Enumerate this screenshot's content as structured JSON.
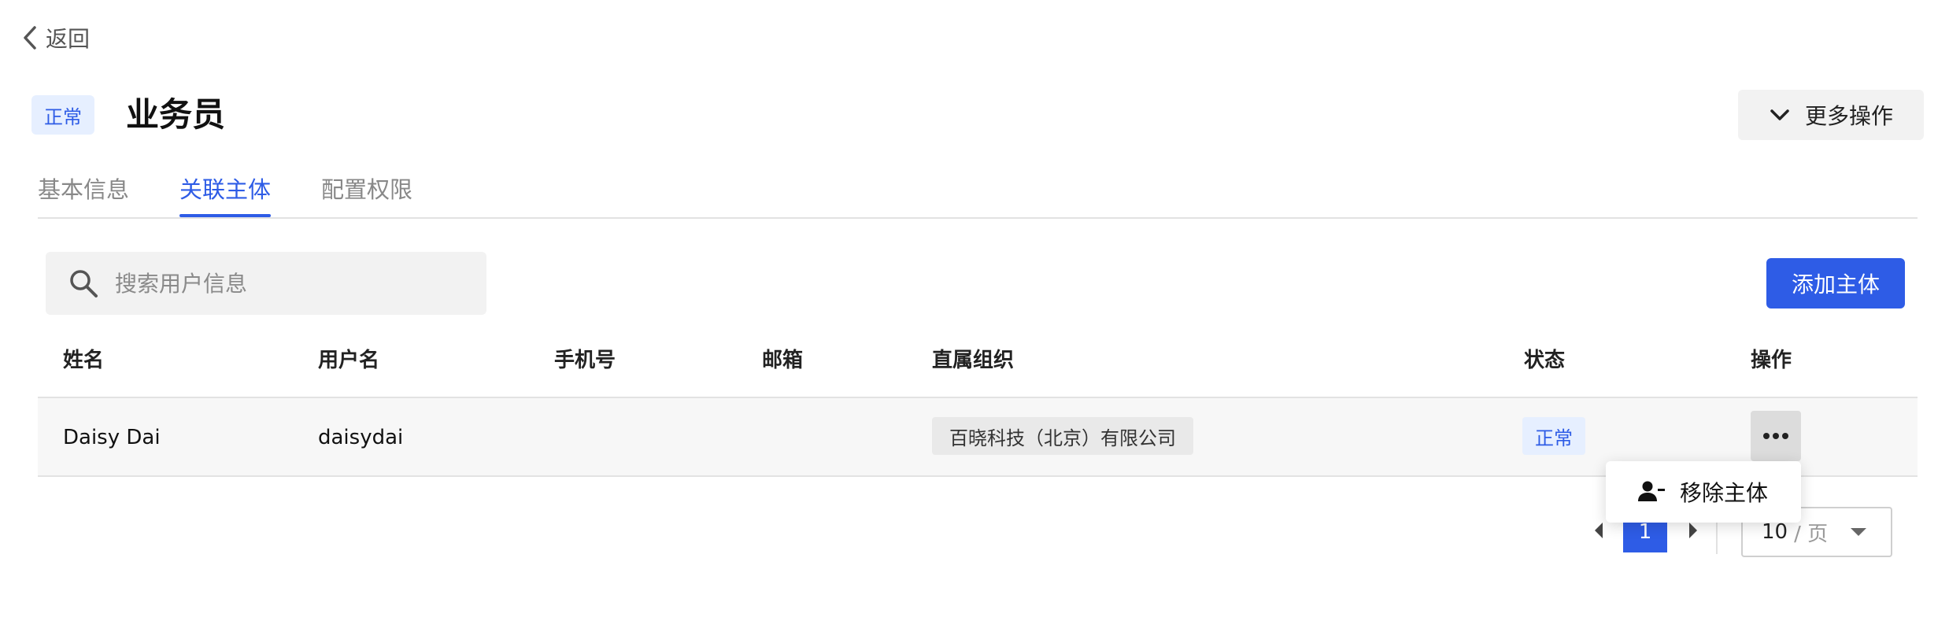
{
  "back": {
    "label": "返回"
  },
  "header": {
    "status": "正常",
    "title": "业务员",
    "more_actions": "更多操作"
  },
  "tabs": [
    {
      "label": "基本信息",
      "active": false
    },
    {
      "label": "关联主体",
      "active": true
    },
    {
      "label": "配置权限",
      "active": false
    }
  ],
  "search": {
    "placeholder": "搜索用户信息",
    "value": ""
  },
  "add_button": "添加主体",
  "table": {
    "headers": [
      "姓名",
      "用户名",
      "手机号",
      "邮箱",
      "直属组织",
      "状态",
      "操作"
    ],
    "rows": [
      {
        "name": "Daisy Dai",
        "username": "daisydai",
        "phone": "",
        "email": "",
        "org": "百晓科技（北京）有限公司",
        "status": "正常"
      }
    ]
  },
  "row_menu": {
    "items": [
      {
        "label": "移除主体",
        "icon": "remove-user-icon"
      }
    ]
  },
  "pagination": {
    "current_page": "1",
    "page_size": "10",
    "page_size_unit": "/ 页"
  },
  "colors": {
    "accent": "#2e5ce6",
    "tag_bg": "#e6efff"
  }
}
